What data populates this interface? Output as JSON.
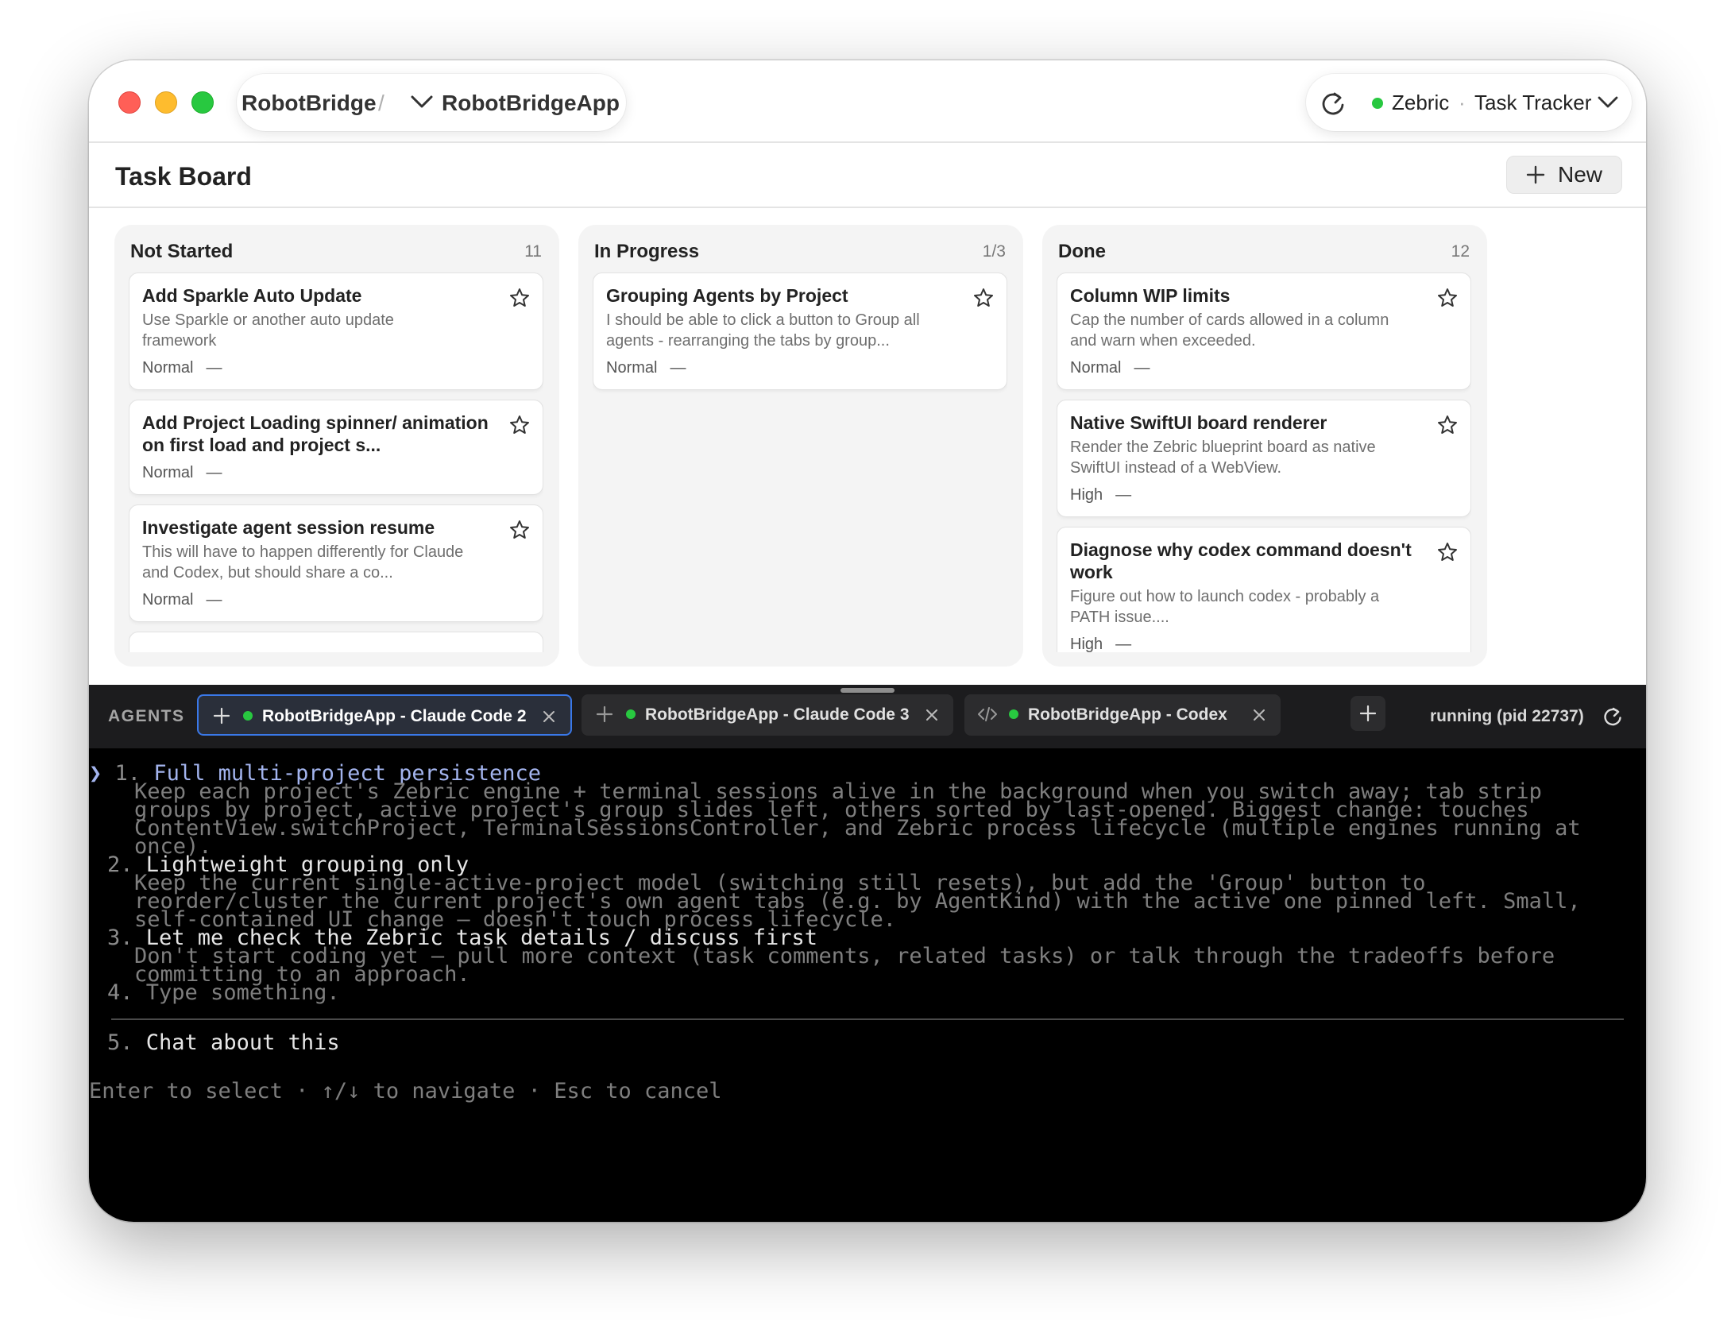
{
  "titlebar": {
    "breadcrumb_root": "RobotBridge",
    "breadcrumb_sep": "/",
    "project": "RobotBridgeApp",
    "workspace": "Zebric",
    "workspace_sep": "·",
    "app": "Task Tracker",
    "status_color": "#28c840"
  },
  "board": {
    "title": "Task Board",
    "new_label": "New",
    "columns": [
      {
        "title": "Not Started",
        "count": "11",
        "cards": [
          {
            "title": "Add Sparkle Auto Update",
            "desc": "Use Sparkle or another auto update framework",
            "priority": "Normal",
            "assignee": "—"
          },
          {
            "title": "Add Project Loading spinner/ animation on first load and project s...",
            "desc": "",
            "priority": "Normal",
            "assignee": "—"
          },
          {
            "title": "Investigate  agent session resume",
            "desc": "This will have to happen differently for Claude and Codex, but should share a co...",
            "priority": "Normal",
            "assignee": "—"
          }
        ]
      },
      {
        "title": "In Progress",
        "count": "1/3",
        "cards": [
          {
            "title": "Grouping Agents by Project",
            "desc": "I should be able to click a button to Group all agents - rearranging the tabs by group...",
            "priority": "Normal",
            "assignee": "—"
          }
        ]
      },
      {
        "title": "Done",
        "count": "12",
        "cards": [
          {
            "title": "Column WIP limits",
            "desc": "Cap the number of cards allowed in a column and warn when exceeded.",
            "priority": "Normal",
            "assignee": "—"
          },
          {
            "title": "Native SwiftUI board renderer",
            "desc": "Render the Zebric blueprint board as native SwiftUI instead of a WebView.",
            "priority": "High",
            "assignee": "—"
          },
          {
            "title": "Diagnose why codex command doesn't work",
            "desc": "Figure out how to launch codex - probably a PATH issue....",
            "priority": "High",
            "assignee": "—"
          }
        ]
      }
    ]
  },
  "agents": {
    "label": "AGENTS",
    "tabs": [
      {
        "label": "RobotBridgeApp - Claude Code 2",
        "icon": "sparkle-icon",
        "active": true
      },
      {
        "label": "RobotBridgeApp - Claude Code 3",
        "icon": "sparkle-icon",
        "active": false
      },
      {
        "label": "RobotBridgeApp - Codex",
        "icon": "code-icon",
        "active": false
      }
    ],
    "status": "running (pid 22737)",
    "active_border_color": "#3a78e8"
  },
  "terminal": {
    "cursor": "❯",
    "options": [
      {
        "num": "1.",
        "title": "Full multi-project persistence",
        "selected": true,
        "desc": [
          "Keep each project's Zebric engine + terminal sessions alive in the background when you switch away; tab strip",
          "groups by project, active project's group slides left, others sorted by last-opened. Biggest change: touches",
          "ContentView.switchProject, TerminalSessionsController, and Zebric process lifecycle (multiple engines running at",
          "once)."
        ]
      },
      {
        "num": "2.",
        "title": "Lightweight grouping only",
        "selected": false,
        "desc": [
          "Keep the current single-active-project model (switching still resets), but add the 'Group' button to",
          "reorder/cluster the current project's own agent tabs (e.g. by AgentKind) with the active one pinned left. Small,",
          "self-contained UI change — doesn't touch process lifecycle."
        ]
      },
      {
        "num": "3.",
        "title": "Let me check the Zebric task details / discuss first",
        "selected": false,
        "desc": [
          "Don't start coding yet — pull more context (task comments, related tasks) or talk through the tradeoffs before",
          "committing to an approach."
        ]
      },
      {
        "num": "4.",
        "title": "Type something.",
        "selected": false,
        "desc": []
      }
    ],
    "extra_option": {
      "num": "5.",
      "title": "Chat about this"
    },
    "footer": "Enter to select · ↑/↓ to navigate · Esc to cancel"
  }
}
